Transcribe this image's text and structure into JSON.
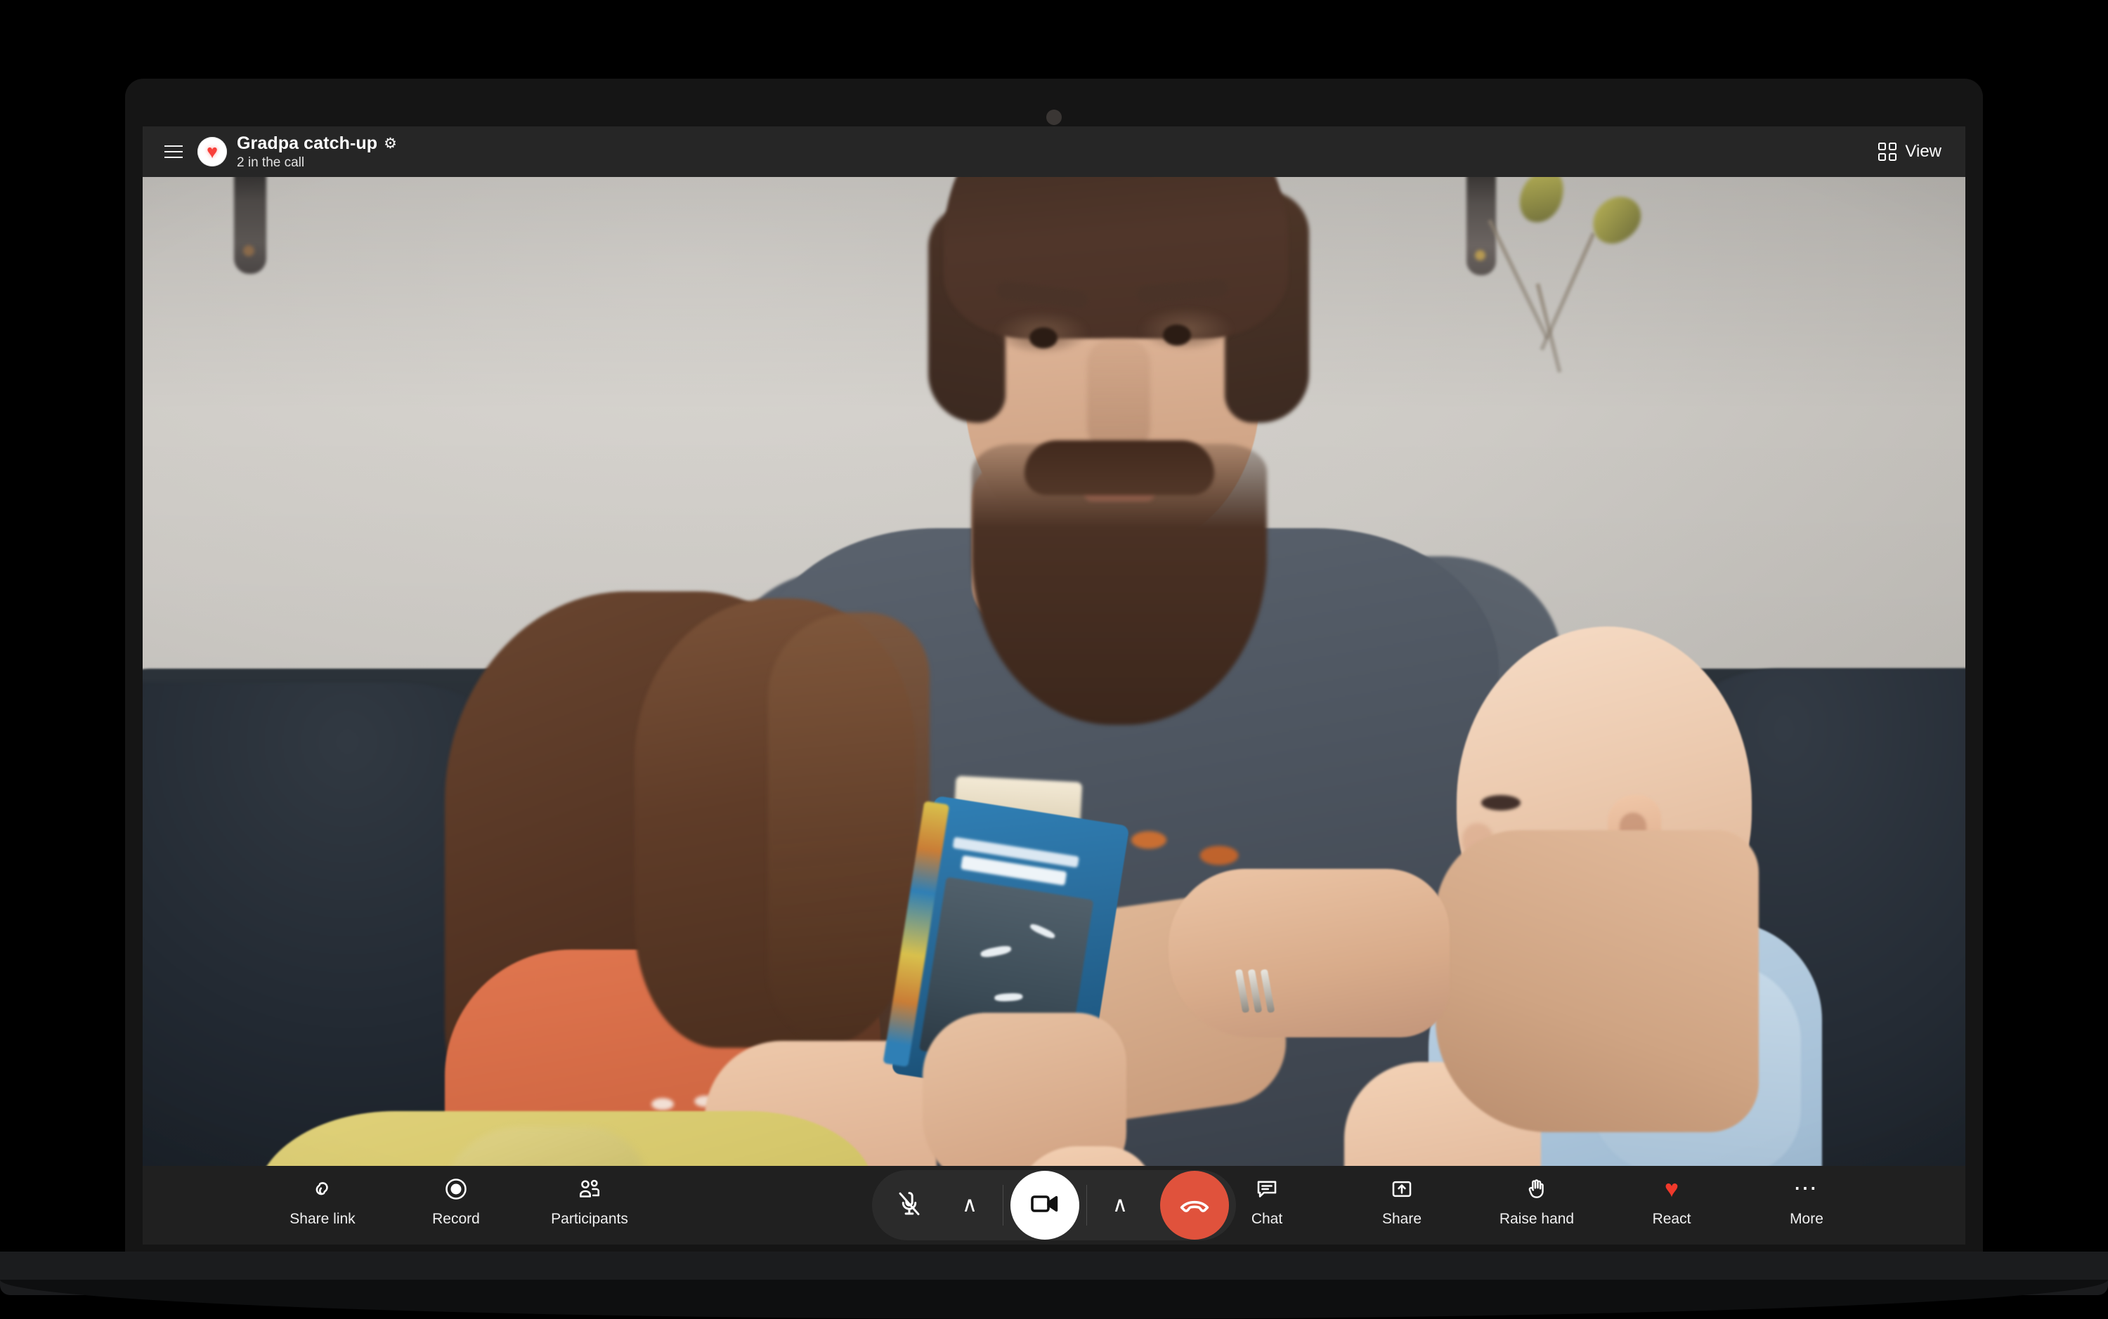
{
  "header": {
    "menu_icon": "hamburger-menu-icon",
    "avatar_icon": "heart-avatar",
    "avatar_glyph": "♥",
    "title": "Gradpa catch-up",
    "settings_icon": "gear-icon",
    "settings_glyph": "⚙",
    "subtitle": "2 in the call",
    "view_button": {
      "label": "View",
      "icon": "grid-view-icon"
    }
  },
  "toolbar": {
    "left_tools": [
      {
        "label": "Share link",
        "icon": "link-icon"
      },
      {
        "label": "Record",
        "icon": "record-icon"
      },
      {
        "label": "Participants",
        "icon": "people-icon"
      }
    ],
    "right_tools": [
      {
        "label": "Chat",
        "icon": "chat-bubble-icon"
      },
      {
        "label": "Share",
        "icon": "share-screen-icon"
      },
      {
        "label": "Raise hand",
        "icon": "raised-hand-icon"
      },
      {
        "label": "React",
        "icon": "heart-icon"
      },
      {
        "label": "More",
        "icon": "ellipsis-icon"
      }
    ],
    "call_controls": {
      "mic": {
        "icon": "microphone-muted-icon",
        "state": "muted"
      },
      "mic_menu": {
        "icon": "chevron-up-icon",
        "glyph": "∧"
      },
      "camera": {
        "icon": "camera-on-icon",
        "state": "on"
      },
      "camera_menu": {
        "icon": "chevron-up-icon",
        "glyph": "∧"
      },
      "hangup": {
        "icon": "end-call-icon"
      }
    }
  },
  "colors": {
    "header_bg": "#262626",
    "toolbar_bg": "#202020",
    "accent_red": "#f0392b",
    "hangup_red": "#e0523c",
    "camera_active": "#ffffff",
    "text_primary": "#ffffff"
  },
  "video": {
    "description": "Video call feed of a bearded man in a grey t-shirt with orange print sitting on a dark couch, holding a blue children's book, a young girl with long brown hair in an orange shirt on his left and a baby in a light blue outfit on his right"
  }
}
